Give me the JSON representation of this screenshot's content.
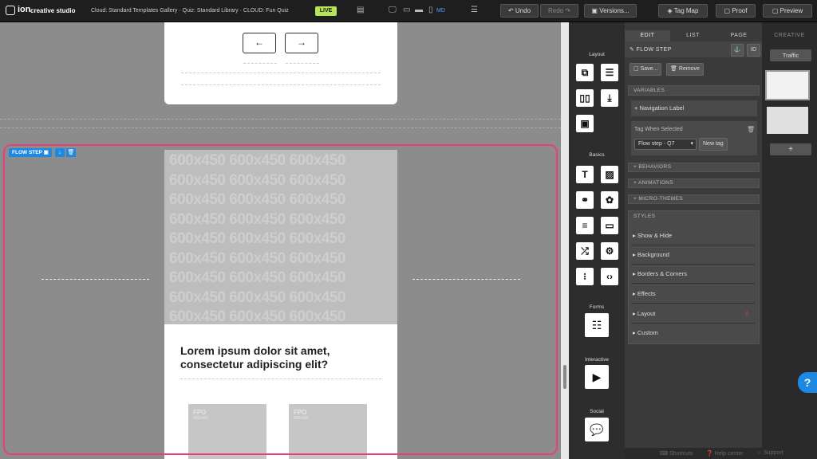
{
  "app": {
    "logo_mark": "ion",
    "logo_text": "creative studio"
  },
  "breadcrumb": "Cloud: Standard Templates Gallery  ·  Quiz: Standard Library  ·  CLOUD: Fun Quiz",
  "status_badge": "LIVE",
  "toolbar": {
    "breakpoint": "MD",
    "undo": "Undo",
    "redo": "Redo",
    "versions": "Versions...",
    "tag_map": "Tag Map",
    "proof": "Proof",
    "preview": "Preview"
  },
  "canvas": {
    "flow_step_label": "FLOW STEP",
    "prev_arrow": "←",
    "next_arrow": "→",
    "placeholder_text": "600x450",
    "heading": "Lorem ipsum dolor sit amet, consectetur adipiscing elit?",
    "fpo_items": [
      {
        "label": "FPO",
        "size": "500x400"
      },
      {
        "label": "FPO",
        "size": "500x400"
      }
    ]
  },
  "widgets": {
    "groups": [
      "Layout",
      "Basics",
      "Forms",
      "Interactive",
      "Social"
    ]
  },
  "panel": {
    "tabs": [
      "EDIT",
      "LIST",
      "PAGE"
    ],
    "header": "FLOW STEP",
    "id_label": "ID",
    "save": "Save...",
    "remove": "Remove",
    "variables": "VARIABLES",
    "nav_label": "+ Navigation Label",
    "tag_when_selected": "Tag When Selected",
    "tag_select": "Flow step - Q7",
    "new_tag": "New tag",
    "behaviors": "+ BEHAVIORS",
    "animations": "+ ANIMATIONS",
    "micro_themes": "+ MICRO-THEMES",
    "styles": "STYLES",
    "style_rows": [
      "Show & Hide",
      "Background",
      "Borders & Corners",
      "Effects",
      "Layout",
      "Custom"
    ]
  },
  "creative": {
    "title": "CREATIVE",
    "traffic": "Traffic",
    "add": "+"
  },
  "footer": {
    "shortcuts": "Shortcuts",
    "help": "Help center",
    "support": "Support"
  },
  "help_button": "?"
}
